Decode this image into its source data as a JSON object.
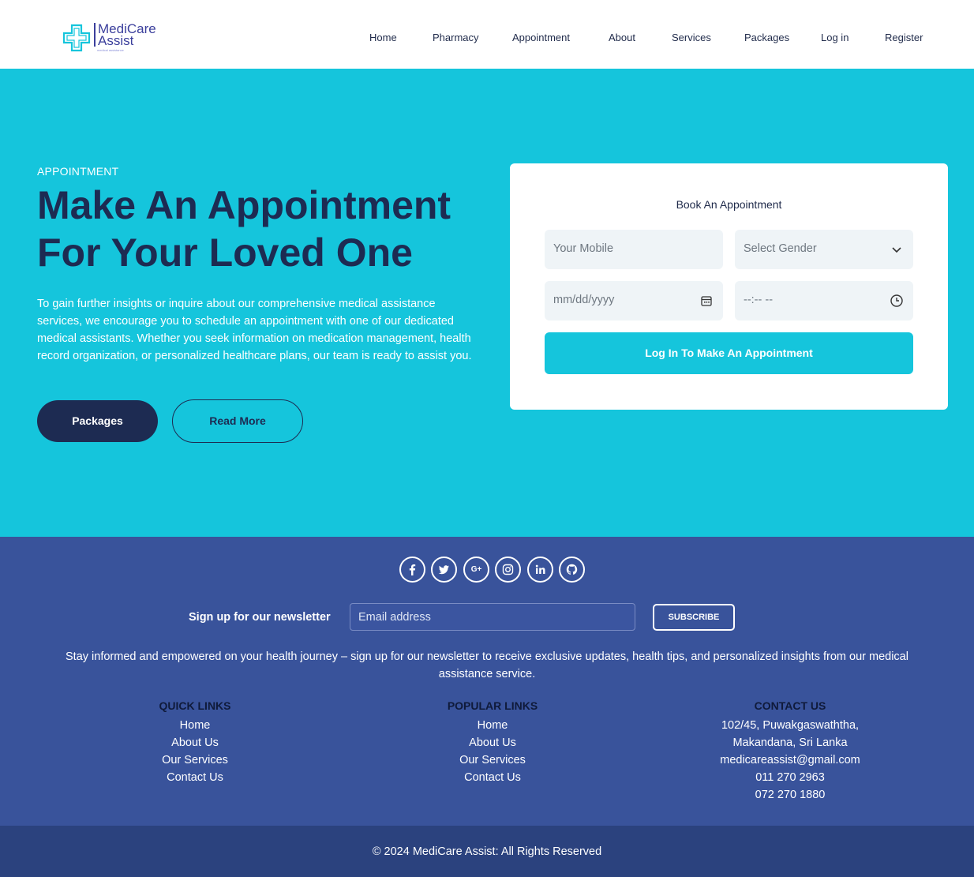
{
  "brand": {
    "name_line1": "MediCare",
    "name_line2": "Assist",
    "tagline": "medical assistance",
    "accent": "#15c5dc",
    "navy": "#1d2b52",
    "footer_bg": "#39539b"
  },
  "nav": {
    "home": "Home",
    "pharmacy": "Pharmacy",
    "appointment": "Appointment",
    "about": "About",
    "services": "Services",
    "packages": "Packages",
    "login": "Log in",
    "register": "Register"
  },
  "hero": {
    "eyebrow": "APPOINTMENT",
    "title": "Make An Appointment For Your Loved One",
    "description": "To gain further insights or inquire about our comprehensive medical assistance services, we encourage you to schedule an appointment with one of our dedicated medical assistants. Whether you seek information on medication management, health record organization, or personalized healthcare plans, our team is ready to assist you.",
    "btn_packages": "Packages",
    "btn_read_more": "Read More"
  },
  "form": {
    "title": "Book An Appointment",
    "mobile_placeholder": "Your Mobile",
    "gender_placeholder": "Select Gender",
    "date_placeholder": "mm/dd/yyyy",
    "time_placeholder": "--:-- --",
    "submit_label": "Log In To Make An Appointment"
  },
  "footer": {
    "social": [
      "facebook-icon",
      "twitter-icon",
      "google-plus-icon",
      "instagram-icon",
      "linkedin-icon",
      "github-icon"
    ],
    "newsletter_label": "Sign up for our newsletter",
    "email_placeholder": "Email address",
    "subscribe_label": "SUBSCRIBE",
    "description": "Stay informed and empowered on your health journey – sign up for our newsletter to receive exclusive updates, health tips, and personalized insights from our medical assistance service.",
    "quick_links": {
      "heading": "QUICK LINKS",
      "items": [
        "Home",
        "About Us",
        "Our Services",
        "Contact Us"
      ]
    },
    "popular_links": {
      "heading": "POPULAR LINKS",
      "items": [
        "Home",
        "About Us",
        "Our Services",
        "Contact Us"
      ]
    },
    "contact": {
      "heading": "CONTACT US",
      "address1": "102/45, Puwakgaswaththa,",
      "address2": "Makandana, Sri Lanka",
      "email": "medicareassist@gmail.com",
      "phone1": "011 270 2963",
      "phone2": "072 270 1880"
    },
    "copyright": "© 2024 MediCare Assist: All Rights Reserved"
  }
}
